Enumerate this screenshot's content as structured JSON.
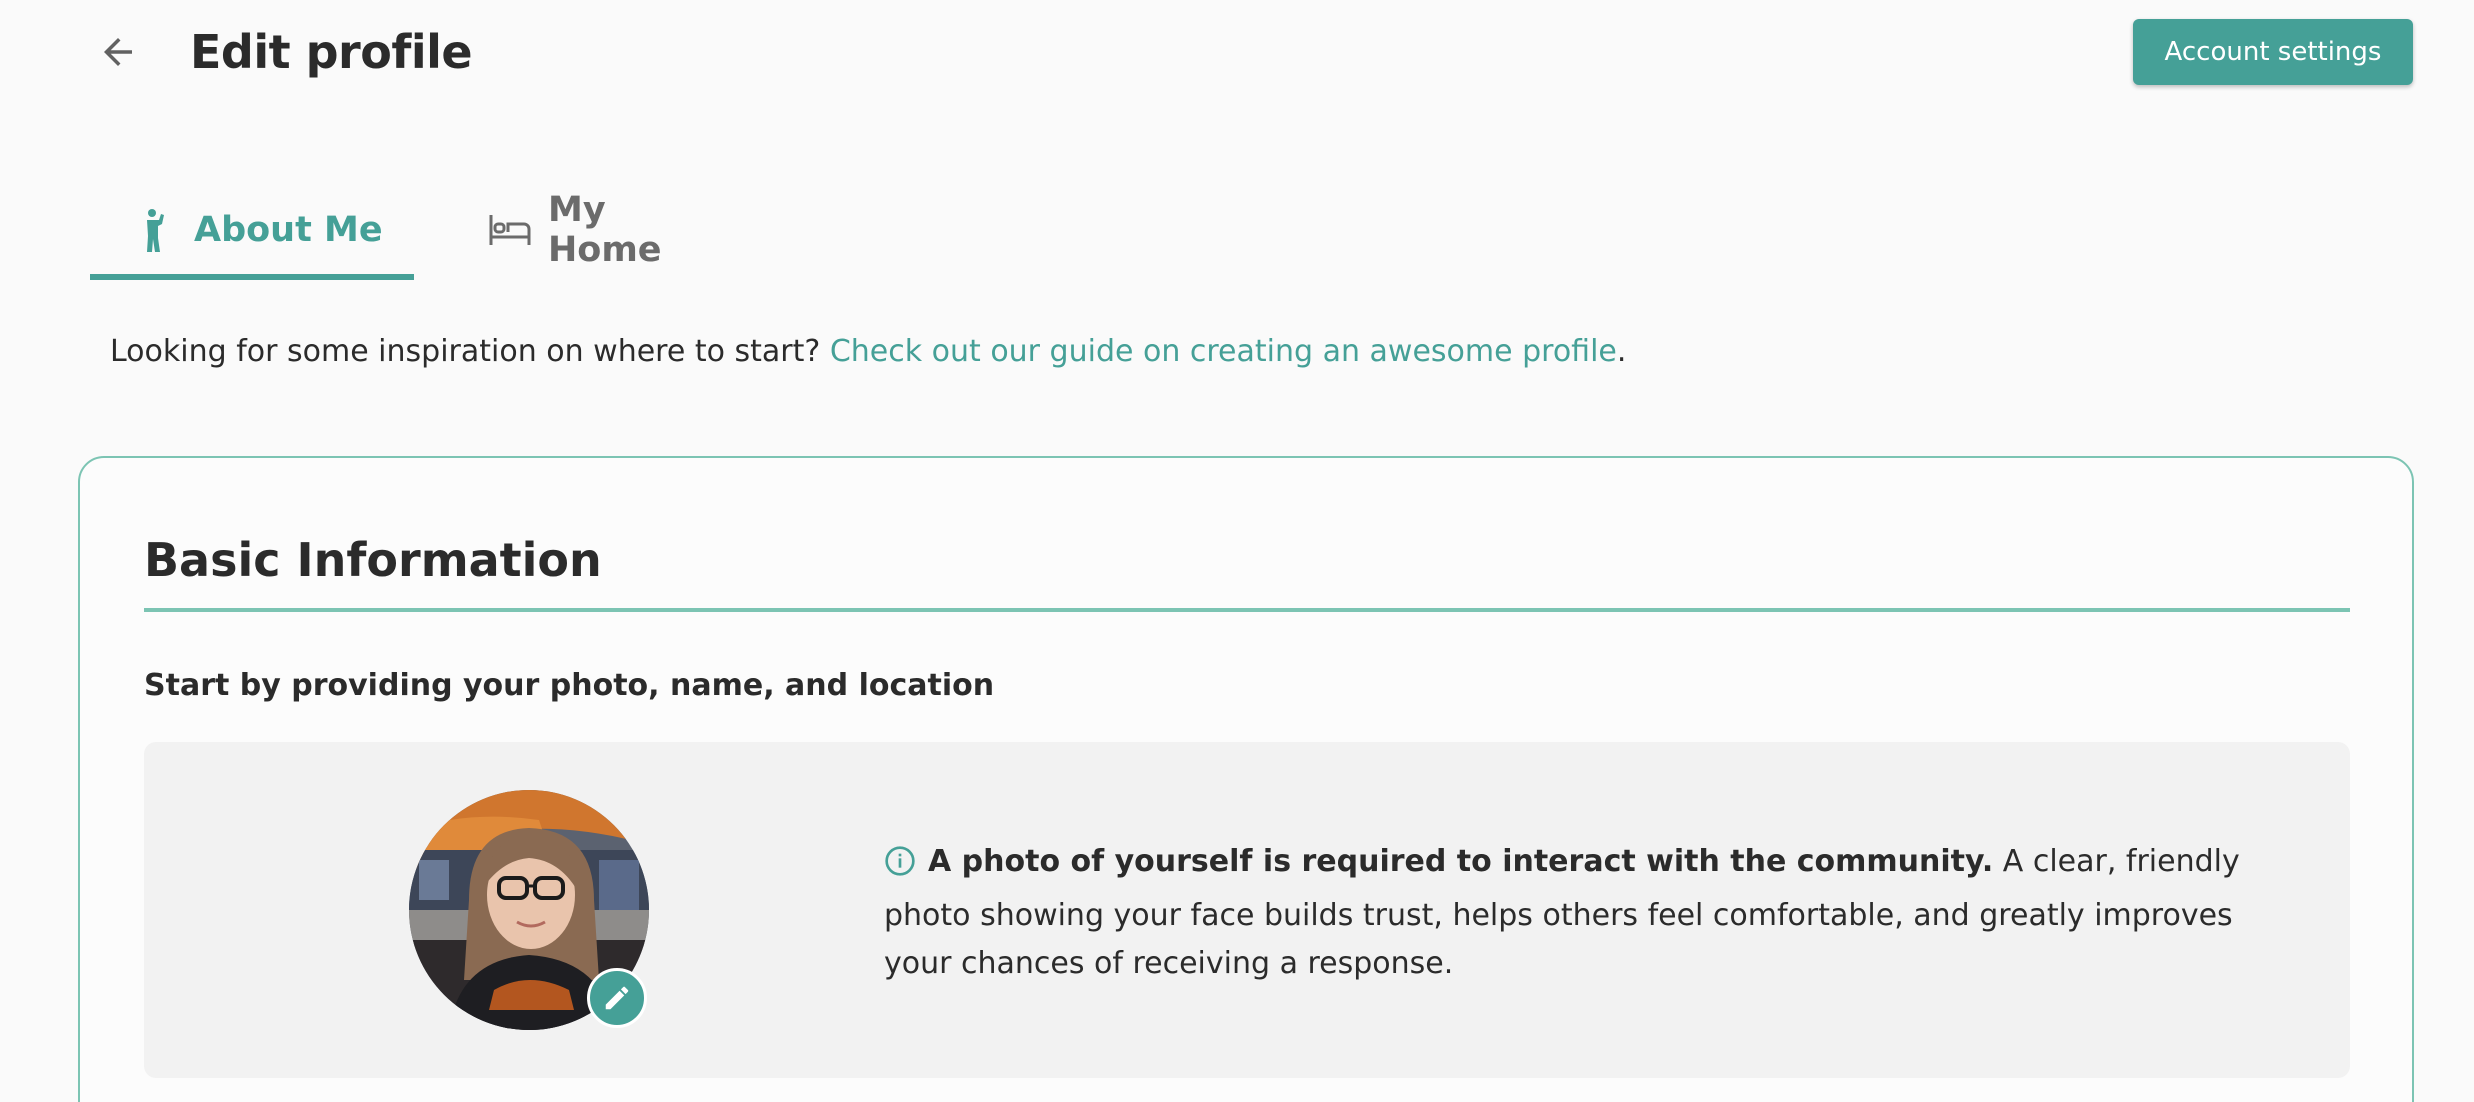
{
  "header": {
    "title": "Edit profile",
    "back_icon": "arrow-left-icon",
    "account_settings_label": "Account settings"
  },
  "tabs": [
    {
      "label": "About Me",
      "icon": "person-waving-icon",
      "active": true
    },
    {
      "label": "My Home",
      "icon": "bed-icon",
      "active": false
    }
  ],
  "intro": {
    "text": "Looking for some inspiration on where to start? ",
    "link_text": "Check out our guide on creating an awesome profile",
    "suffix": "."
  },
  "basic_info": {
    "title": "Basic Information",
    "subtitle": "Start by providing your photo, name, and location",
    "photo_notice_bold": "A photo of yourself is required to interact with the community.",
    "photo_notice_text": " A clear, friendly photo showing your face builds trust, helps others feel comfortable, and greatly improves your chances of receiving a response.",
    "edit_icon": "pencil-icon",
    "info_icon": "info-circle-icon"
  },
  "colors": {
    "accent": "#45a097",
    "accent_light": "#7cc4b3",
    "text": "#2b2b2b",
    "muted": "#6b6b6b",
    "panel": "#f2f2f2"
  }
}
